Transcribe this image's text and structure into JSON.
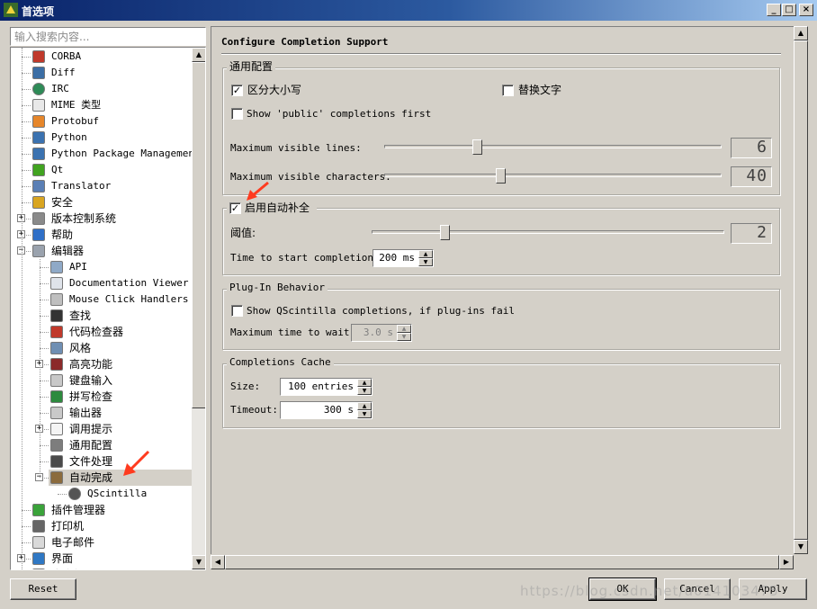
{
  "window": {
    "title": "首选项",
    "controls": {
      "minimize": "_",
      "maximize": "□",
      "close": "×"
    }
  },
  "search": {
    "placeholder": "输入搜索内容..."
  },
  "tree": {
    "items": [
      {
        "label": "CORBA",
        "icon": "corba-icon",
        "cn": false
      },
      {
        "label": "Diff",
        "icon": "diff-icon",
        "cn": false
      },
      {
        "label": "IRC",
        "icon": "irc-icon",
        "cn": false
      },
      {
        "label": "MIME 类型",
        "icon": "mime-icon",
        "cn": false
      },
      {
        "label": "Protobuf",
        "icon": "protobuf-icon",
        "cn": false
      },
      {
        "label": "Python",
        "icon": "python-icon",
        "cn": false
      },
      {
        "label": "Python Package Management",
        "icon": "python-package-icon",
        "cn": false
      },
      {
        "label": "Qt",
        "icon": "qt-icon",
        "cn": false
      },
      {
        "label": "Translator",
        "icon": "translator-icon",
        "cn": false
      },
      {
        "label": "安全",
        "icon": "lock-icon",
        "cn": true
      },
      {
        "label": "版本控制系统",
        "icon": "vcs-icon",
        "cn": true,
        "expander": "+"
      },
      {
        "label": "帮助",
        "icon": "help-icon",
        "cn": true,
        "expander": "+"
      },
      {
        "label": "编辑器",
        "icon": "editor-icon",
        "cn": true,
        "expander": "−"
      },
      {
        "label": "API",
        "icon": "api-icon",
        "cn": false,
        "indent": 1
      },
      {
        "label": "Documentation Viewer",
        "icon": "documentation-icon",
        "cn": false,
        "indent": 1
      },
      {
        "label": "Mouse Click Handlers",
        "icon": "mouse-icon",
        "cn": false,
        "indent": 1
      },
      {
        "label": "查找",
        "icon": "binoculars-icon",
        "cn": true,
        "indent": 1
      },
      {
        "label": "代码检查器",
        "icon": "bug-icon",
        "cn": true,
        "indent": 1
      },
      {
        "label": "风格",
        "icon": "style-icon",
        "cn": true,
        "indent": 1
      },
      {
        "label": "高亮功能",
        "icon": "font-icon",
        "cn": true,
        "indent": 1,
        "expander": "+"
      },
      {
        "label": "键盘输入",
        "icon": "keyboard-icon",
        "cn": true,
        "indent": 1
      },
      {
        "label": "拼写检查",
        "icon": "spellcheck-icon",
        "cn": true,
        "indent": 1
      },
      {
        "label": "输出器",
        "icon": "export-icon",
        "cn": true,
        "indent": 1
      },
      {
        "label": "调用提示",
        "icon": "lightbulb-icon",
        "cn": true,
        "indent": 1,
        "expander": "+"
      },
      {
        "label": "通用配置",
        "icon": "wrench-icon",
        "cn": true,
        "indent": 1
      },
      {
        "label": "文件处理",
        "icon": "floppy-icon",
        "cn": true,
        "indent": 1
      },
      {
        "label": "自动完成",
        "icon": "wand-icon",
        "cn": true,
        "indent": 1,
        "expander": "−",
        "selected": true
      },
      {
        "label": "QScintilla",
        "icon": "qscintilla-icon",
        "cn": false,
        "indent": 2
      },
      {
        "label": "插件管理器",
        "icon": "plugin-icon",
        "cn": true
      },
      {
        "label": "打印机",
        "icon": "printer-icon",
        "cn": true
      },
      {
        "label": "电子邮件",
        "icon": "email-icon",
        "cn": true
      },
      {
        "label": "界面",
        "icon": "monitor-icon",
        "cn": true,
        "expander": "+"
      },
      {
        "label": "命令行",
        "icon": "console-icon",
        "cn": true
      }
    ]
  },
  "page": {
    "title": "Configure Completion Support",
    "general": {
      "title": "通用配置",
      "case_sensitive": {
        "label": "区分大小写",
        "checked": true
      },
      "replace_word": {
        "label": "替换文字",
        "checked": false
      },
      "show_public": {
        "label": "Show 'public' completions first",
        "checked": false
      },
      "max_lines": {
        "label": "Maximum visible lines:",
        "value": "6",
        "fraction": 0.27
      },
      "max_chars": {
        "label": "Maximum visible characters:",
        "value": "40",
        "fraction": 0.34
      }
    },
    "auto": {
      "title": "启用自动补全",
      "checked": true,
      "threshold": {
        "label": "阈值:",
        "value": "2",
        "fraction": 0.2
      },
      "time": {
        "label": "Time to start completion:",
        "value": "200 ms"
      }
    },
    "plugin": {
      "title": "Plug-In Behavior",
      "show_qsci": {
        "label": "Show QScintilla completions, if plug-ins fail",
        "checked": false
      },
      "max_wait": {
        "label": "Maximum time to wait:",
        "value": "3.0 s"
      }
    },
    "cache": {
      "title": "Completions Cache",
      "size": {
        "label": "Size:",
        "value": "100 entries"
      },
      "timeout": {
        "label": "Timeout:",
        "value": "300 s"
      }
    }
  },
  "buttons": {
    "reset": "Reset",
    "ok": "OK",
    "cancel": "Cancel",
    "apply": "Apply"
  },
  "colors": {
    "annotation_arrow": "#ff3b1f",
    "title_bar": "#0a246a"
  },
  "watermark": "https://blog.csdn.net/u014103475"
}
